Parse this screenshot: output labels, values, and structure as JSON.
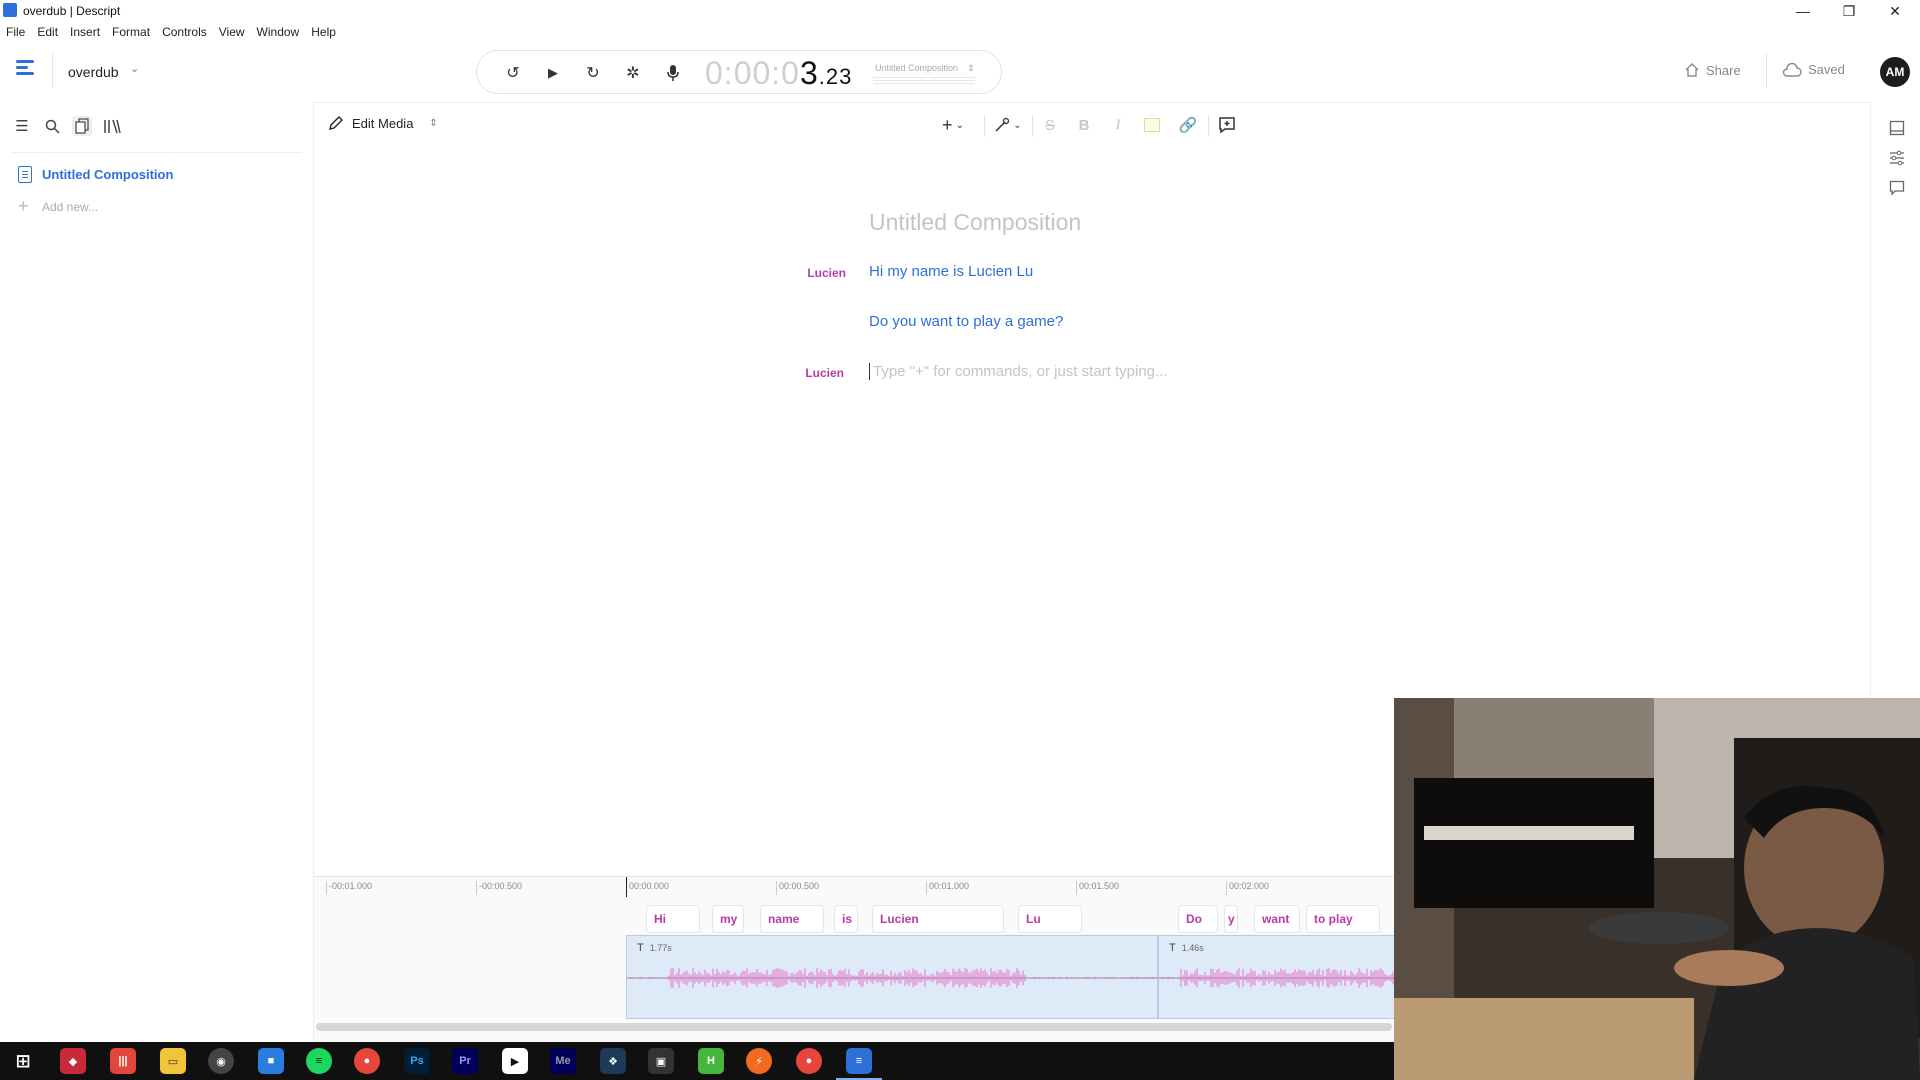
{
  "window": {
    "title": "overdub | Descript",
    "controls": [
      "minimize",
      "restore",
      "close"
    ]
  },
  "menu": [
    "File",
    "Edit",
    "Insert",
    "Format",
    "Controls",
    "View",
    "Window",
    "Help"
  ],
  "toolbar": {
    "project_name": "overdub",
    "timecode_dim": "0:00:0",
    "timecode_main": "3",
    "timecode_fraction": ".23",
    "composition_select": "Untitled Composition",
    "share_label": "Share",
    "saved_label": "Saved",
    "avatar_initials": "AM"
  },
  "sidebar": {
    "composition_item": "Untitled Composition",
    "add_new": "Add new..."
  },
  "editor": {
    "mode_label": "Edit Media",
    "title": "Untitled Composition",
    "paragraphs": [
      {
        "speaker": "Lucien",
        "text": "Hi my name is Lucien Lu"
      },
      {
        "speaker": "",
        "text": "Do you want to play a game?"
      },
      {
        "speaker": "Lucien",
        "placeholder": "Type \"+\" for commands, or just start typing..."
      }
    ]
  },
  "timeline": {
    "ticks": [
      "-00:01.000",
      "-00:00.500",
      "00:00.000",
      "00:00.500",
      "00:01.000",
      "00:01.500",
      "00:02.000"
    ],
    "words": [
      "Hi",
      "my",
      "name",
      "is",
      "Lucien",
      "Lu",
      "Do",
      "y",
      "want",
      "to play"
    ],
    "clips": [
      {
        "duration": "1.77s"
      },
      {
        "duration": "1.46s"
      }
    ]
  },
  "colors": {
    "accent": "#2f6fd8",
    "speaker": "#b83ba6",
    "clip_bg": "#dfeaf9",
    "waveform": "#e487cf"
  },
  "taskbar": {
    "apps": [
      "windows-start",
      "app-red",
      "app-stripes",
      "file-explorer",
      "obs",
      "app-blue",
      "spotify",
      "chrome",
      "photoshop",
      "premiere",
      "app-play",
      "media-encoder",
      "app-blueprint",
      "app-camera",
      "app-h",
      "app-orange",
      "chrome-profile",
      "descript"
    ]
  }
}
